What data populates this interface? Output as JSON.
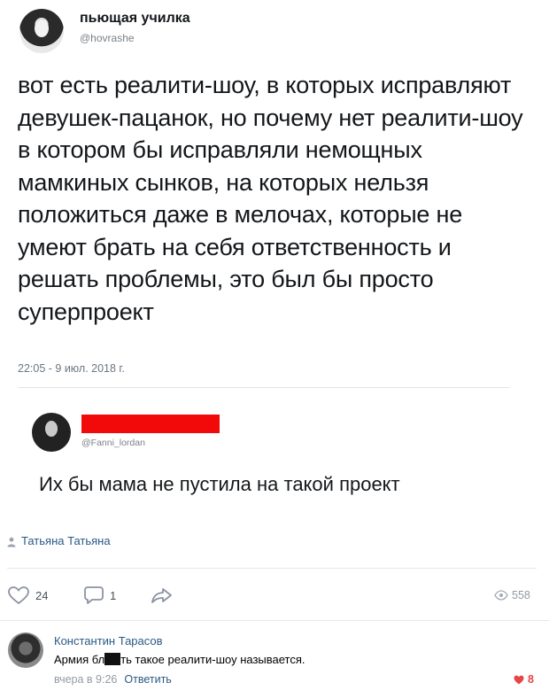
{
  "tweet": {
    "author_name": "пьющая училка",
    "author_handle": "@hovrashe",
    "text": "вот есть реалити-шоу, в которых исправляют девушек-пацанок, но почему нет реалити-шоу в котором бы исправляли немощных мамкиных сынков, на которых нельзя положиться даже в мелочах, которые не умеют брать на себя ответственность и решать проблемы, это был бы просто суперпроект",
    "timestamp": "22:05 - 9 июл. 2018 г."
  },
  "reply": {
    "author_handle": "@Fanni_lordan",
    "text": "Их бы мама не пустила на такой проект",
    "name_redaction_color": "#f20a0a"
  },
  "post": {
    "signature": "Татьяна Татьяна",
    "likes": "24",
    "comments": "1",
    "views": "558"
  },
  "comment": {
    "author": "Константин Тарасов",
    "text_before": "Армия бл",
    "text_after": "ть такое реалити-шоу называется.",
    "time": "вчера в 9:26",
    "reply_label": "Ответить",
    "likes": "8"
  },
  "colors": {
    "link": "#2a5885",
    "heart": "#e64646"
  },
  "icons": [
    "heart-icon",
    "comment-icon",
    "share-icon",
    "eye-icon",
    "person-icon"
  ]
}
